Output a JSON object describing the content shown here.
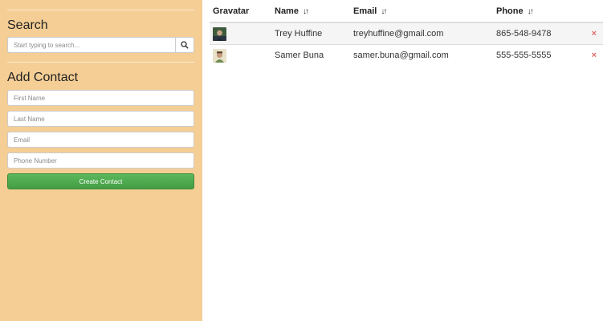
{
  "sidebar": {
    "search_heading": "Search",
    "search_placeholder": "Start typing to search...",
    "add_heading": "Add Contact",
    "fields": {
      "first_name": "First Name",
      "last_name": "Last Name",
      "email": "Email",
      "phone": "Phone Number"
    },
    "create_label": "Create Contact"
  },
  "table": {
    "headers": [
      "Gravatar",
      "Name",
      "Email",
      "Phone"
    ],
    "sort_glyph": "↓↑",
    "rows": [
      {
        "name": "Trey Huffine",
        "email": "treyhuffine@gmail.com",
        "phone": "865-548-9478",
        "delete": "×"
      },
      {
        "name": "Samer Buna",
        "email": "samer.buna@gmail.com",
        "phone": "555-555-5555",
        "delete": "×"
      }
    ]
  },
  "colors": {
    "sidebar_bg": "#f4ce95",
    "create_button": "#5cb85c",
    "delete_icon": "#e06a6a",
    "striped_row": "#f5f5f5"
  }
}
